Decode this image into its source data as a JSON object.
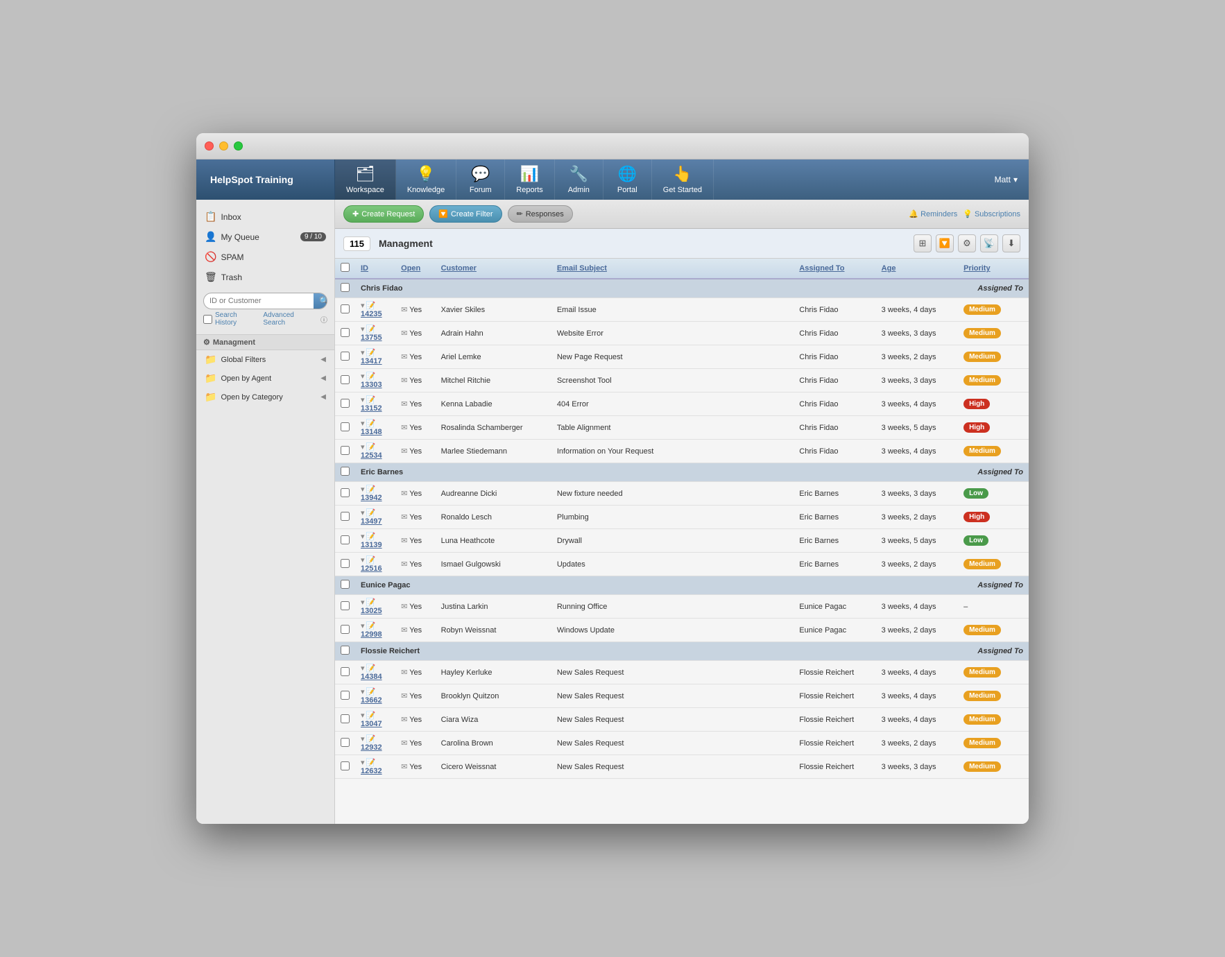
{
  "app": {
    "title": "HelpSpot Training",
    "user": "Matt"
  },
  "nav": {
    "items": [
      {
        "id": "workspace",
        "label": "Workspace",
        "icon": "🗂",
        "active": true
      },
      {
        "id": "knowledge",
        "label": "Knowledge",
        "icon": "💡"
      },
      {
        "id": "forum",
        "label": "Forum",
        "icon": "💬"
      },
      {
        "id": "reports",
        "label": "Reports",
        "icon": "📊"
      },
      {
        "id": "admin",
        "label": "Admin",
        "icon": "🔧"
      },
      {
        "id": "portal",
        "label": "Portal",
        "icon": "🌐"
      },
      {
        "id": "get-started",
        "label": "Get Started",
        "icon": "👆"
      }
    ]
  },
  "sidebar": {
    "items": [
      {
        "id": "inbox",
        "label": "Inbox",
        "icon": "📋",
        "badge": null
      },
      {
        "id": "my-queue",
        "label": "My Queue",
        "icon": "👤",
        "badge": "9 / 10"
      },
      {
        "id": "spam",
        "label": "SPAM",
        "icon": "🚫",
        "badge": null
      },
      {
        "id": "trash",
        "label": "Trash",
        "icon": "🗑",
        "badge": null
      }
    ],
    "search": {
      "placeholder": "ID or Customer",
      "history_label": "Search History",
      "advanced_label": "Advanced Search"
    },
    "sections": [
      {
        "id": "managment",
        "label": "Managment",
        "active": true
      },
      {
        "id": "global-filters",
        "label": "Global Filters",
        "expandable": true
      },
      {
        "id": "open-by-agent",
        "label": "Open by Agent",
        "expandable": true
      },
      {
        "id": "open-by-category",
        "label": "Open by Category",
        "expandable": true
      }
    ]
  },
  "toolbar": {
    "create_request": "Create Request",
    "create_filter": "Create Filter",
    "responses": "Responses",
    "reminders": "Reminders",
    "subscriptions": "Subscriptions"
  },
  "table": {
    "count": "115",
    "title": "Managment",
    "columns": [
      "ID",
      "Open",
      "Customer",
      "Email Subject",
      "Assigned To",
      "Age",
      "Priority"
    ],
    "groups": [
      {
        "group_name": "Chris Fidao",
        "assigned_label": "Assigned To",
        "rows": [
          {
            "id": "14235",
            "open": "Yes",
            "customer": "Xavier Skiles",
            "subject": "Email Issue",
            "assigned": "Chris Fidao",
            "age": "3 weeks, 4 days",
            "priority": "Medium",
            "priority_type": "medium"
          },
          {
            "id": "13755",
            "open": "Yes",
            "customer": "Adrain Hahn",
            "subject": "Website Error",
            "assigned": "Chris Fidao",
            "age": "3 weeks, 3 days",
            "priority": "Medium",
            "priority_type": "medium"
          },
          {
            "id": "13417",
            "open": "Yes",
            "customer": "Ariel Lemke",
            "subject": "New Page Request",
            "assigned": "Chris Fidao",
            "age": "3 weeks, 2 days",
            "priority": "Medium",
            "priority_type": "medium"
          },
          {
            "id": "13303",
            "open": "Yes",
            "customer": "Mitchel Ritchie",
            "subject": "Screenshot Tool",
            "assigned": "Chris Fidao",
            "age": "3 weeks, 3 days",
            "priority": "Medium",
            "priority_type": "medium"
          },
          {
            "id": "13152",
            "open": "Yes",
            "customer": "Kenna Labadie",
            "subject": "404 Error",
            "assigned": "Chris Fidao",
            "age": "3 weeks, 4 days",
            "priority": "High",
            "priority_type": "high"
          },
          {
            "id": "13148",
            "open": "Yes",
            "customer": "Rosalinda Schamberger",
            "subject": "Table Alignment",
            "assigned": "Chris Fidao",
            "age": "3 weeks, 5 days",
            "priority": "High",
            "priority_type": "high"
          },
          {
            "id": "12534",
            "open": "Yes",
            "customer": "Marlee Stiedemann",
            "subject": "Information on Your Request",
            "assigned": "Chris Fidao",
            "age": "3 weeks, 4 days",
            "priority": "Medium",
            "priority_type": "medium"
          }
        ]
      },
      {
        "group_name": "Eric Barnes",
        "assigned_label": "Assigned To",
        "rows": [
          {
            "id": "13942",
            "open": "Yes",
            "customer": "Audreanne Dicki",
            "subject": "New fixture needed",
            "assigned": "Eric Barnes",
            "age": "3 weeks, 3 days",
            "priority": "Low",
            "priority_type": "low"
          },
          {
            "id": "13497",
            "open": "Yes",
            "customer": "Ronaldo Lesch",
            "subject": "Plumbing",
            "assigned": "Eric Barnes",
            "age": "3 weeks, 2 days",
            "priority": "High",
            "priority_type": "high"
          },
          {
            "id": "13139",
            "open": "Yes",
            "customer": "Luna Heathcote",
            "subject": "Drywall",
            "assigned": "Eric Barnes",
            "age": "3 weeks, 5 days",
            "priority": "Low",
            "priority_type": "low"
          },
          {
            "id": "12516",
            "open": "Yes",
            "customer": "Ismael Gulgowski",
            "subject": "Updates",
            "assigned": "Eric Barnes",
            "age": "3 weeks, 2 days",
            "priority": "Medium",
            "priority_type": "medium"
          }
        ]
      },
      {
        "group_name": "Eunice Pagac",
        "assigned_label": "Assigned To",
        "rows": [
          {
            "id": "13025",
            "open": "Yes",
            "customer": "Justina Larkin",
            "subject": "Running Office",
            "assigned": "Eunice Pagac",
            "age": "3 weeks, 4 days",
            "priority": "–",
            "priority_type": "none"
          },
          {
            "id": "12998",
            "open": "Yes",
            "customer": "Robyn Weissnat",
            "subject": "Windows Update",
            "assigned": "Eunice Pagac",
            "age": "3 weeks, 2 days",
            "priority": "Medium",
            "priority_type": "medium"
          }
        ]
      },
      {
        "group_name": "Flossie Reichert",
        "assigned_label": "Assigned To",
        "rows": [
          {
            "id": "14384",
            "open": "Yes",
            "customer": "Hayley Kerluke",
            "subject": "New Sales Request",
            "assigned": "Flossie Reichert",
            "age": "3 weeks, 4 days",
            "priority": "Medium",
            "priority_type": "medium"
          },
          {
            "id": "13662",
            "open": "Yes",
            "customer": "Brooklyn Quitzon",
            "subject": "New Sales Request",
            "assigned": "Flossie Reichert",
            "age": "3 weeks, 4 days",
            "priority": "Medium",
            "priority_type": "medium"
          },
          {
            "id": "13047",
            "open": "Yes",
            "customer": "Ciara Wiza",
            "subject": "New Sales Request",
            "assigned": "Flossie Reichert",
            "age": "3 weeks, 4 days",
            "priority": "Medium",
            "priority_type": "medium"
          },
          {
            "id": "12932",
            "open": "Yes",
            "customer": "Carolina Brown",
            "subject": "New Sales Request",
            "assigned": "Flossie Reichert",
            "age": "3 weeks, 2 days",
            "priority": "Medium",
            "priority_type": "medium"
          },
          {
            "id": "12632",
            "open": "Yes",
            "customer": "Cicero Weissnat",
            "subject": "New Sales Request",
            "assigned": "Flossie Reichert",
            "age": "3 weeks, 3 days",
            "priority": "Medium",
            "priority_type": "medium"
          }
        ]
      }
    ]
  }
}
